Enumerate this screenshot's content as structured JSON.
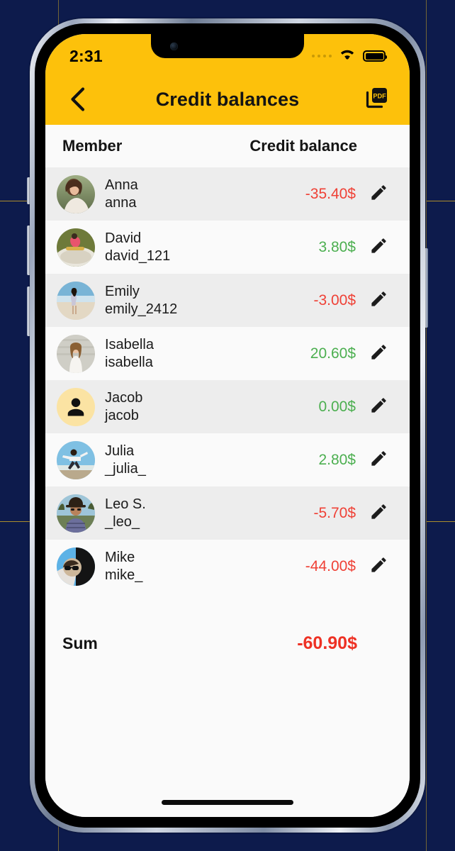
{
  "background": {
    "color": "#0d1b4c",
    "line_color": "#c9a227"
  },
  "device": {
    "frame": "iphone",
    "home_indicator": true
  },
  "status_bar": {
    "time": "2:31",
    "icons": [
      "signal-dots-icon",
      "wifi-icon",
      "battery-icon"
    ],
    "signal_dots": 4,
    "battery_full": true
  },
  "app_bar": {
    "back_icon": "chevron-left-icon",
    "title": "Credit balances",
    "action_icon": "pdf-export-icon",
    "action_label": "PDF",
    "background": "#FDC10B"
  },
  "table": {
    "columns": {
      "member": "Member",
      "balance": "Credit balance"
    },
    "edit_icon": "pencil-icon",
    "colors": {
      "negative": "#ef4136",
      "positive": "#4caf50",
      "row_odd": "#ededed",
      "row_even": "#fafafa"
    },
    "rows": [
      {
        "name": "Anna",
        "username": "anna",
        "balance": "-35.40$",
        "sign": "neg",
        "avatar": "photo-woman-field"
      },
      {
        "name": "David",
        "username": "david_121",
        "balance": "3.80$",
        "sign": "pos",
        "avatar": "photo-man-boat"
      },
      {
        "name": "Emily",
        "username": "emily_2412",
        "balance": "-3.00$",
        "sign": "neg",
        "avatar": "photo-woman-beach"
      },
      {
        "name": "Isabella",
        "username": "isabella",
        "balance": "20.60$",
        "sign": "pos",
        "avatar": "photo-woman-white-dress"
      },
      {
        "name": "Jacob",
        "username": "jacob",
        "balance": "0.00$",
        "sign": "pos",
        "avatar": "placeholder-person"
      },
      {
        "name": "Julia",
        "username": "_julia_",
        "balance": "2.80$",
        "sign": "pos",
        "avatar": "photo-woman-jumping"
      },
      {
        "name": "Leo S.",
        "username": "_leo_",
        "balance": "-5.70$",
        "sign": "neg",
        "avatar": "photo-man-hat"
      },
      {
        "name": "Mike",
        "username": "mike_",
        "balance": "-44.00$",
        "sign": "neg",
        "avatar": "photo-man-sunglasses"
      }
    ]
  },
  "summary": {
    "label": "Sum",
    "value": "-60.90$",
    "color": "#ee3124"
  }
}
